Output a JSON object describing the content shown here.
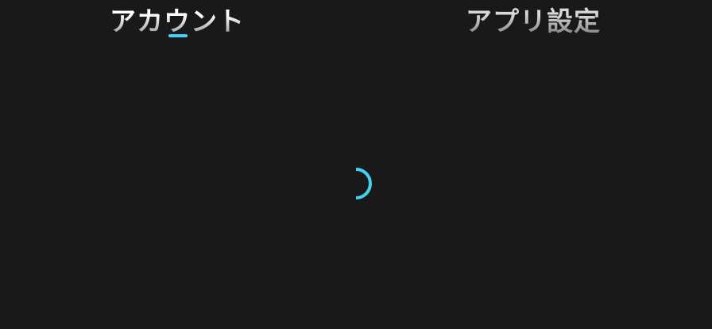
{
  "tabs": [
    {
      "label": "アカウント",
      "active": true
    },
    {
      "label": "アプリ設定",
      "active": false
    }
  ],
  "colors": {
    "accent": "#3fd5f2",
    "background": "#191919"
  },
  "loading": true
}
